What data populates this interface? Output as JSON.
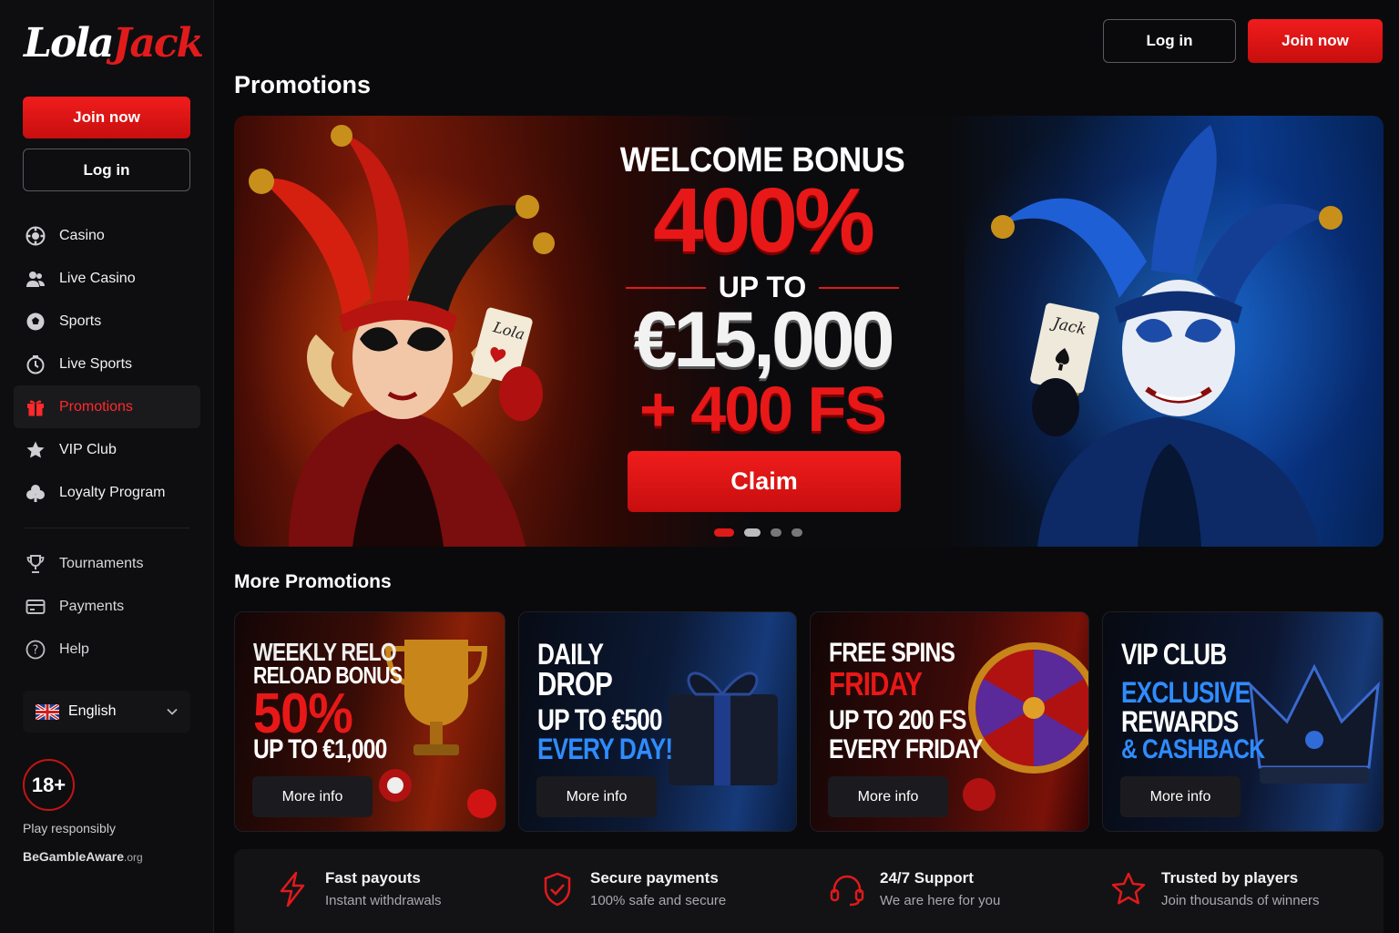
{
  "brand": {
    "name_part1": "Lola",
    "name_part2": "Jack"
  },
  "header": {
    "login_label": "Log in",
    "join_label": "Join now"
  },
  "sidebar": {
    "join_label": "Join now",
    "login_label": "Log in",
    "items": [
      {
        "label": "Casino",
        "icon": "casino-chip-icon"
      },
      {
        "label": "Live Casino",
        "icon": "live-dealer-icon"
      },
      {
        "label": "Sports",
        "icon": "soccer-ball-icon"
      },
      {
        "label": "Live Sports",
        "icon": "live-clock-icon"
      },
      {
        "label": "Promotions",
        "icon": "gift-icon",
        "active": true
      },
      {
        "label": "VIP Club",
        "icon": "star-icon"
      },
      {
        "label": "Loyalty Program",
        "icon": "loyalty-icon"
      }
    ],
    "items2": [
      {
        "label": "Tournaments",
        "icon": "trophy-icon"
      },
      {
        "label": "Payments",
        "icon": "card-icon"
      },
      {
        "label": "Help",
        "icon": "help-icon"
      }
    ],
    "language": "English",
    "age_badge": "18+",
    "play_responsibly": "Play responsibly",
    "gamble_aware": "BeGambleAware",
    "gamble_aware_suffix": ".org"
  },
  "page": {
    "title": "Promotions",
    "more_title": "More Promotions"
  },
  "hero": {
    "headline": "WELCOME BONUS",
    "percent": "400%",
    "up_to": "UP TO",
    "amount": "€15,000",
    "free_spins": "+ 400 FS",
    "cta": "Claim",
    "carousel_total": 4,
    "carousel_active": 1,
    "card_left": "Lola",
    "card_right": "Jack"
  },
  "cards": [
    {
      "line1": "WEEKLY RELO",
      "line2": "RELOAD BONUS",
      "big": "50%",
      "line4": "UP TO €1,000",
      "cta": "More info"
    },
    {
      "line1": "DAILY",
      "line2": "DROP",
      "line3": "UP TO €500",
      "line4": "EVERY DAY!",
      "cta": "More info"
    },
    {
      "line1": "FREE SPINS",
      "line2": "FRIDAY",
      "line3": "UP TO 200 FS",
      "line4": "EVERY FRIDAY",
      "cta": "More info"
    },
    {
      "line1": "VIP CLUB",
      "line2": "EXCLUSIVE",
      "line3": "REWARDS",
      "line4": "& CASHBACK",
      "cta": "More info"
    }
  ],
  "features": [
    {
      "title": "Fast payouts",
      "sub": "Instant withdrawals",
      "icon": "lightning-icon"
    },
    {
      "title": "Secure payments",
      "sub": "100% safe and secure",
      "icon": "shield-check-icon"
    },
    {
      "title": "24/7 Support",
      "sub": "We are here for you",
      "icon": "headset-icon"
    },
    {
      "title": "Trusted by players",
      "sub": "Join thousands of winners",
      "icon": "star-outline-icon"
    }
  ],
  "colors": {
    "accent": "#e01a1a",
    "background": "#0a0a0c",
    "sidebar": "#0e0e10"
  }
}
